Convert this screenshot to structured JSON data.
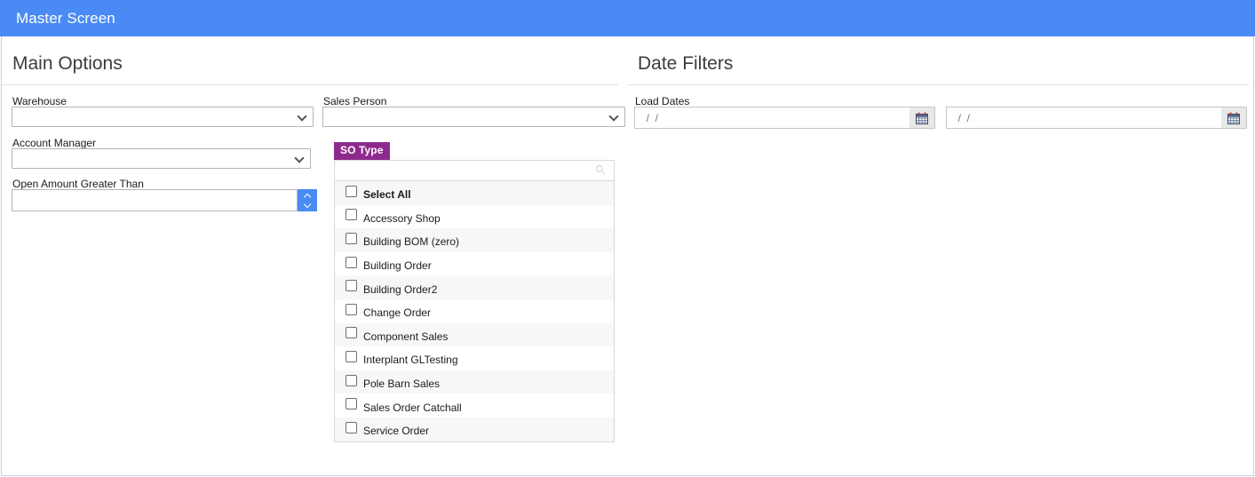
{
  "window": {
    "title": "Master Screen",
    "header_color": "#4a8af4",
    "border_color": "#bed3ea"
  },
  "sections": {
    "main": {
      "title": "Main Options"
    },
    "dates": {
      "title": "Date Filters"
    }
  },
  "main_options": {
    "warehouse": {
      "label": "Warehouse",
      "value": "",
      "icon": "chevron-down-icon"
    },
    "account_manager": {
      "label": "Account Manager",
      "value": "",
      "icon": "chevron-down-icon"
    },
    "open_amount": {
      "label": "Open Amount Greater Than",
      "value": "",
      "placeholder": "",
      "spinner_color": "#4a8af4"
    },
    "sales_person": {
      "label": "Sales Person",
      "value": "",
      "icon": "chevron-down-icon"
    }
  },
  "so_type": {
    "badge_label": "SO Type",
    "badge_color": "#8e2a8e",
    "search": {
      "value": "",
      "placeholder": "",
      "icon": "search-icon"
    },
    "select_all_label": "Select All",
    "items": [
      {
        "label": "Accessory Shop",
        "checked": false
      },
      {
        "label": "Building BOM (zero)",
        "checked": false
      },
      {
        "label": "Building Order",
        "checked": false
      },
      {
        "label": "Building Order2",
        "checked": false
      },
      {
        "label": "Change Order",
        "checked": false
      },
      {
        "label": "Component Sales",
        "checked": false
      },
      {
        "label": "Interplant GLTesting",
        "checked": false
      },
      {
        "label": "Pole Barn Sales",
        "checked": false
      },
      {
        "label": "Sales Order Catchall",
        "checked": false
      },
      {
        "label": "Service Order",
        "checked": false
      }
    ]
  },
  "date_filters": {
    "load_dates": {
      "label": "Load Dates",
      "from": {
        "value": "",
        "placeholder": "  /  /",
        "icon": "calendar-icon"
      },
      "to": {
        "value": "",
        "placeholder": "  /  /",
        "icon": "calendar-icon"
      }
    }
  }
}
